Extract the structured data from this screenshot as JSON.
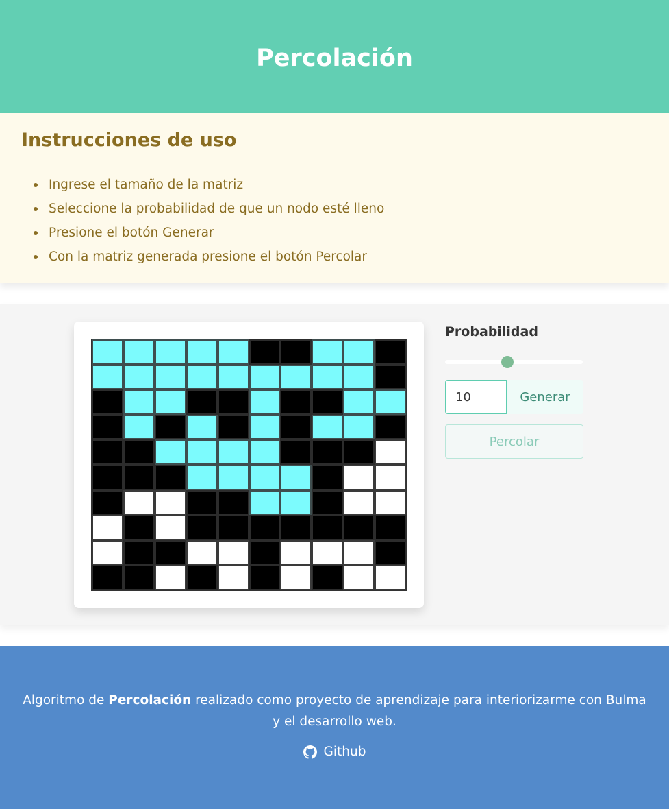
{
  "hero": {
    "title": "Percolación"
  },
  "instructions": {
    "title": "Instrucciones de uso",
    "items": [
      "Ingrese el tamaño de la matriz",
      "Seleccione la probabilidad de que un nodo esté lleno",
      "Presione el botón Generar",
      "Con la matriz generada presione el botón Percolar"
    ]
  },
  "matrix": {
    "size": 10,
    "legend": {
      "f": "percolated",
      "e": "blocked",
      "w": "open"
    },
    "rows": [
      [
        "f",
        "f",
        "f",
        "f",
        "f",
        "e",
        "e",
        "f",
        "f",
        "e"
      ],
      [
        "f",
        "f",
        "f",
        "f",
        "f",
        "f",
        "f",
        "f",
        "f",
        "e"
      ],
      [
        "e",
        "f",
        "f",
        "e",
        "e",
        "f",
        "e",
        "e",
        "f",
        "f"
      ],
      [
        "e",
        "f",
        "e",
        "f",
        "e",
        "f",
        "e",
        "f",
        "f",
        "e"
      ],
      [
        "e",
        "e",
        "f",
        "f",
        "f",
        "f",
        "e",
        "e",
        "e",
        "w"
      ],
      [
        "e",
        "e",
        "e",
        "f",
        "f",
        "f",
        "f",
        "e",
        "w",
        "w"
      ],
      [
        "e",
        "w",
        "w",
        "e",
        "e",
        "f",
        "f",
        "e",
        "w",
        "w"
      ],
      [
        "w",
        "e",
        "w",
        "e",
        "e",
        "e",
        "e",
        "e",
        "e",
        "e"
      ],
      [
        "w",
        "e",
        "e",
        "w",
        "w",
        "e",
        "w",
        "w",
        "w",
        "e"
      ],
      [
        "e",
        "e",
        "w",
        "e",
        "w",
        "e",
        "w",
        "e",
        "w",
        "w"
      ]
    ],
    "colors": {
      "filled": "#7cfbfd",
      "blocked": "#000000",
      "open": "#ffffff"
    }
  },
  "controls": {
    "probability_label": "Probabilidad",
    "probability_value": 0.45,
    "size_input_value": "10",
    "generate_label": "Generar",
    "percolate_label": "Percolar"
  },
  "footer": {
    "text_before": "Algoritmo de ",
    "bold": "Percolación",
    "text_middle": " realizado como proyecto de aprendizaje para interiorizarme con ",
    "link": "Bulma",
    "text_after": " y el desarrollo web.",
    "github_label": "Github"
  },
  "colors": {
    "hero": "#62cfb3",
    "notice_bg": "#fefaeb",
    "notice_text": "#8a6d22",
    "footer": "#538acb",
    "slider_thumb": "#7ebc95"
  }
}
